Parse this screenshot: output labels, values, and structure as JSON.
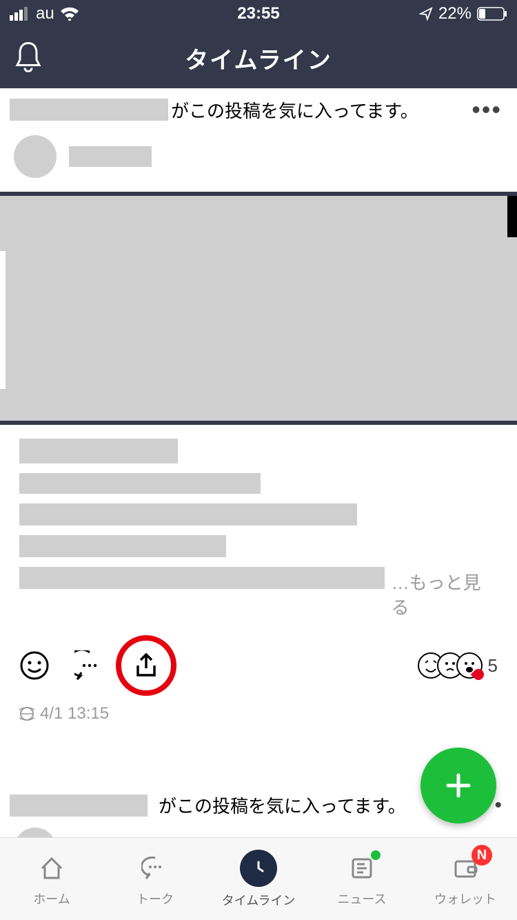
{
  "status": {
    "carrier": "au",
    "time": "23:55",
    "battery_pct": "22%"
  },
  "header": {
    "title": "タイムライン"
  },
  "post1": {
    "liked_suffix": "がこの投稿を気に入ってます。",
    "more_link": "…もっと見る",
    "reaction_count": "5",
    "timestamp": "4/1 13:15"
  },
  "post2": {
    "liked_suffix": "がこの投稿を気に入ってます。"
  },
  "tabs": {
    "home": "ホーム",
    "talk": "トーク",
    "timeline": "タイムライン",
    "news": "ニュース",
    "wallet": "ウォレット",
    "wallet_badge": "N"
  }
}
